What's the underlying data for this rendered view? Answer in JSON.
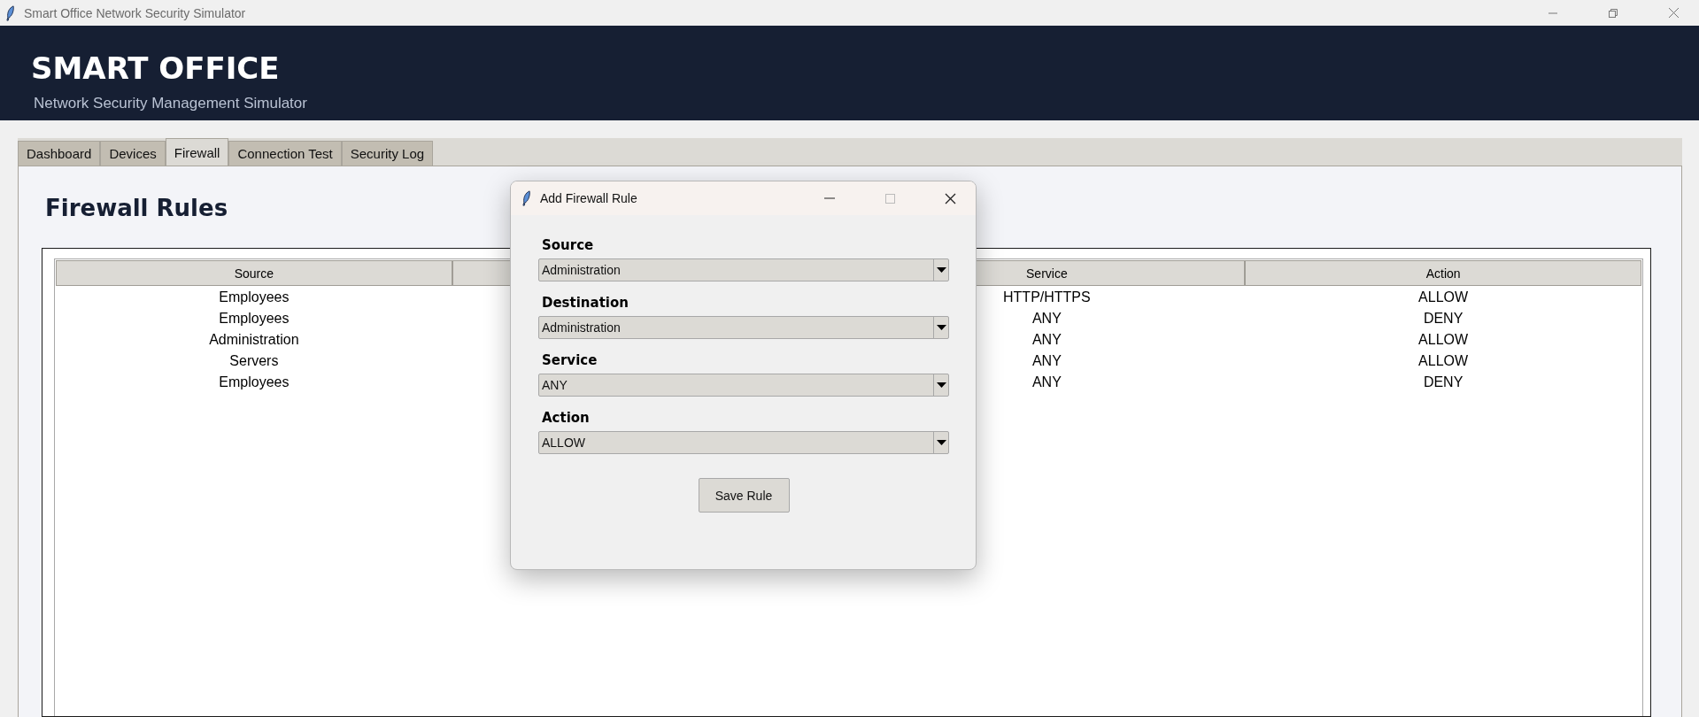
{
  "window": {
    "title": "Smart Office Network Security Simulator"
  },
  "header": {
    "title": "SMART OFFICE",
    "subtitle": "Network Security Management Simulator"
  },
  "tabs": [
    {
      "label": "Dashboard",
      "selected": false
    },
    {
      "label": "Devices",
      "selected": false
    },
    {
      "label": "Firewall",
      "selected": true
    },
    {
      "label": "Connection Test",
      "selected": false
    },
    {
      "label": "Security Log",
      "selected": false
    }
  ],
  "page": {
    "heading": "Firewall Rules"
  },
  "table": {
    "columns": [
      {
        "label": "Source"
      },
      {
        "label": "Service"
      },
      {
        "label": "Action"
      }
    ],
    "rows": [
      {
        "source": "Employees",
        "service": "HTTP/HTTPS",
        "action": "ALLOW"
      },
      {
        "source": "Employees",
        "service": "ANY",
        "action": "DENY"
      },
      {
        "source": "Administration",
        "service": "ANY",
        "action": "ALLOW"
      },
      {
        "source": "Servers",
        "service": "ANY",
        "action": "ALLOW"
      },
      {
        "source": "Employees",
        "service": "ANY",
        "action": "DENY"
      }
    ]
  },
  "dialog": {
    "title": "Add Firewall Rule",
    "fields": [
      {
        "label": "Source",
        "value": "Administration"
      },
      {
        "label": "Destination",
        "value": "Administration"
      },
      {
        "label": "Service",
        "value": "ANY"
      },
      {
        "label": "Action",
        "value": "ALLOW"
      }
    ],
    "button": "Save Rule"
  }
}
